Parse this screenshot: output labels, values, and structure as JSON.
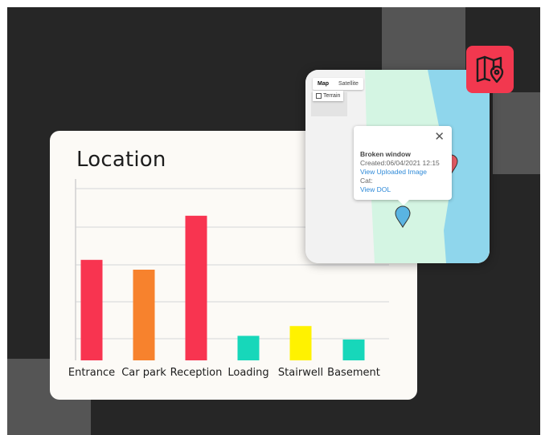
{
  "chart_card": {
    "title": "Location"
  },
  "chart_data": {
    "type": "bar",
    "title": "Location",
    "xlabel": "",
    "ylabel": "",
    "grid": true,
    "categories": [
      "Entrance",
      "Car park",
      "Reception",
      "Loading",
      "Stairwell",
      "Basement"
    ],
    "values": [
      82,
      74,
      118,
      20,
      28,
      17
    ],
    "colors": [
      "#f83450",
      "#f7822d",
      "#f83450",
      "#17d7ba",
      "#fff200",
      "#17d7ba"
    ],
    "ylim": [
      0,
      148
    ]
  },
  "map": {
    "type_control": {
      "map_label": "Map",
      "satellite_label": "Satellite",
      "selected": "Map"
    },
    "terrain_label": "Terrain",
    "popup": {
      "title": "Broken window",
      "created": "Created:06/04/2021 12:15",
      "view_image_link": "View Uploaded Image",
      "cat": "Cat:",
      "view_dol_link": "View DOL",
      "close_icon": "close-icon"
    },
    "pin_colors": {
      "selected": "#5ab4e2",
      "other": "#e05a63"
    },
    "water_color": "#8fd6ec",
    "park_color": "#d4f5e3"
  },
  "map_button": {
    "icon": "map-pin-icon",
    "color": "#f2384f"
  }
}
